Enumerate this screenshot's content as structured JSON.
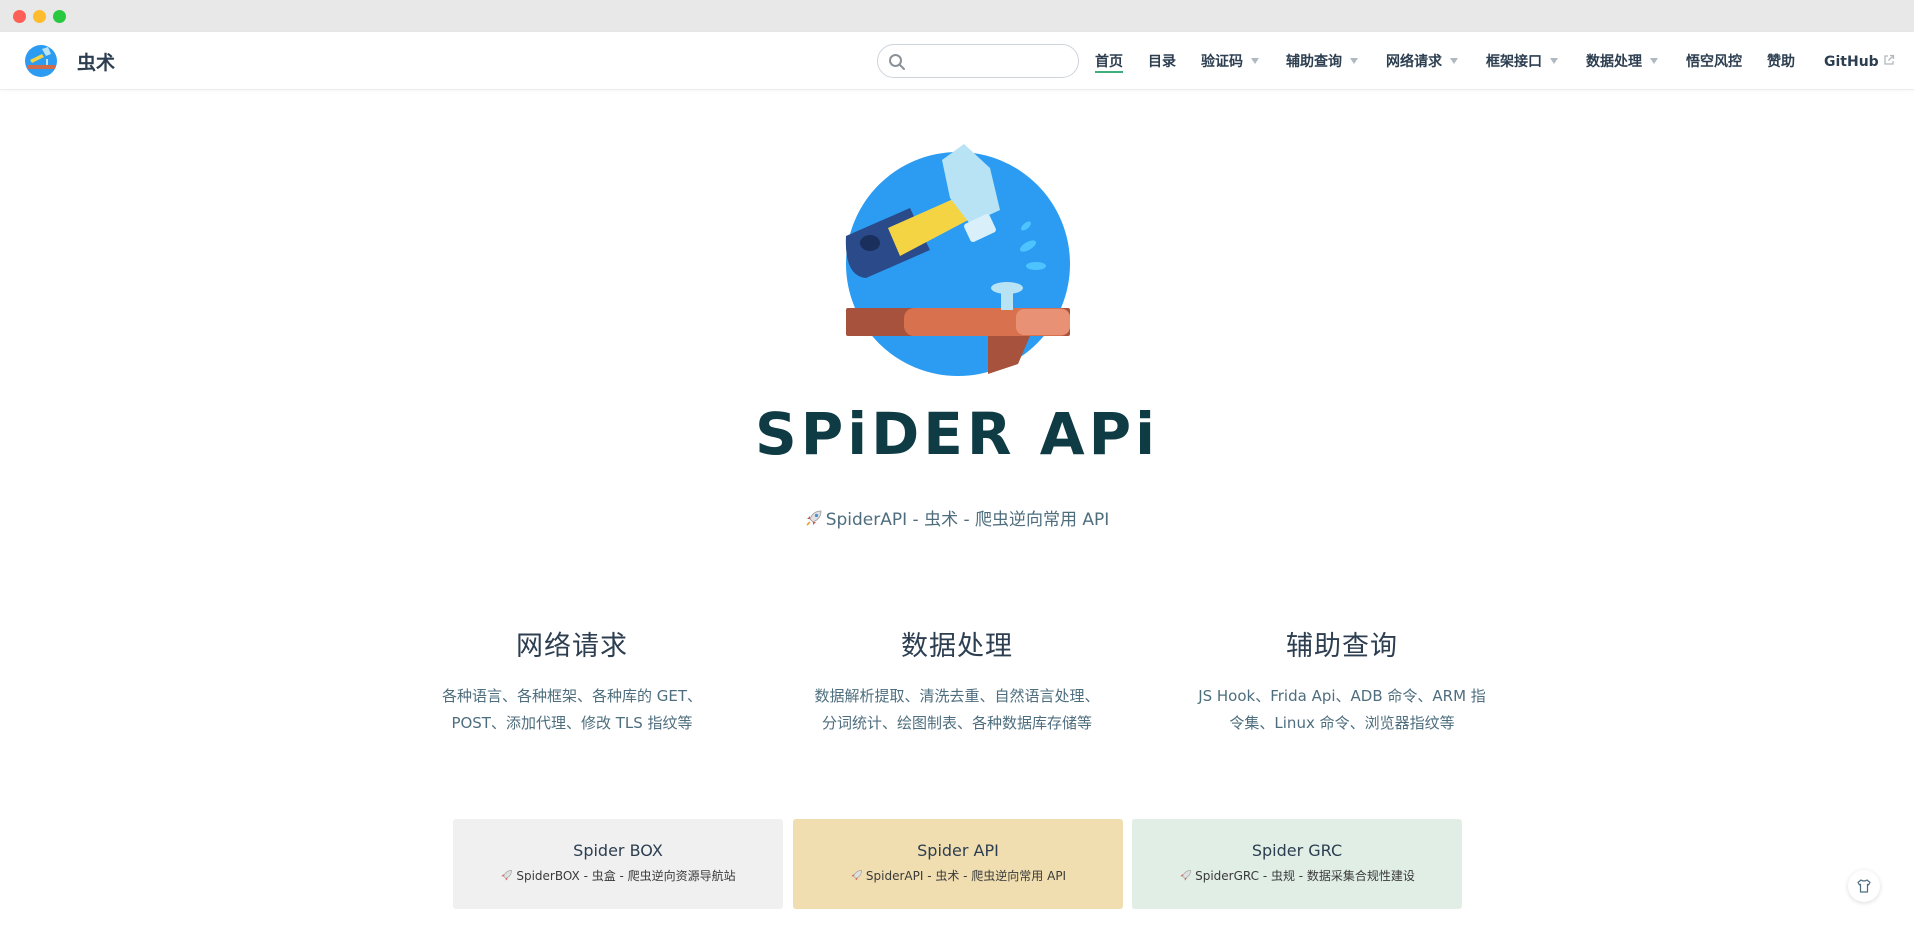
{
  "site": {
    "name": "虫术"
  },
  "search": {
    "placeholder": ""
  },
  "nav": {
    "items": [
      {
        "label": "首页",
        "active": true,
        "dropdown": false
      },
      {
        "label": "目录",
        "active": false,
        "dropdown": false
      },
      {
        "label": "验证码",
        "active": false,
        "dropdown": true
      },
      {
        "label": "辅助查询",
        "active": false,
        "dropdown": true
      },
      {
        "label": "网络请求",
        "active": false,
        "dropdown": true
      },
      {
        "label": "框架接口",
        "active": false,
        "dropdown": true
      },
      {
        "label": "数据处理",
        "active": false,
        "dropdown": true
      },
      {
        "label": "悟空风控",
        "active": false,
        "dropdown": false
      },
      {
        "label": "赞助",
        "active": false,
        "dropdown": false
      },
      {
        "label": "GitHub",
        "active": false,
        "dropdown": false,
        "external": true
      }
    ]
  },
  "hero": {
    "title": "SPiDER APi",
    "description": "SpiderAPI - 虫术 - 爬虫逆向常用 API"
  },
  "features": [
    {
      "title": "网络请求",
      "line1": "各种语言、各种框架、各种库的 GET、",
      "line2": "POST、添加代理、修改 TLS 指纹等"
    },
    {
      "title": "数据处理",
      "line1": "数据解析提取、清洗去重、自然语言处理、",
      "line2": "分词统计、绘图制表、各种数据库存储等"
    },
    {
      "title": "辅助查询",
      "line1": "JS Hook、Frida Api、ADB 命令、ARM 指",
      "line2": "令集、Linux 命令、浏览器指纹等"
    }
  ],
  "cards": [
    {
      "title": "Spider BOX",
      "desc": "SpiderBOX - 虫盒 - 爬虫逆向资源导航站",
      "bg": "#f0f0f0"
    },
    {
      "title": "Spider API",
      "desc": "SpiderAPI - 虫术 - 爬虫逆向常用 API",
      "bg": "#f0deb0"
    },
    {
      "title": "Spider GRC",
      "desc": "SpiderGRC - 虫规 - 数据采集合规性建设",
      "bg": "#e0eee6"
    }
  ],
  "colors": {
    "accent": "#3eaf7c",
    "text": "#2c3e50",
    "title": "#0f3b45"
  },
  "icons": {
    "search": "search-icon",
    "external": "external-link-icon",
    "rocket": "rocket-icon",
    "theme": "shirt-icon"
  }
}
